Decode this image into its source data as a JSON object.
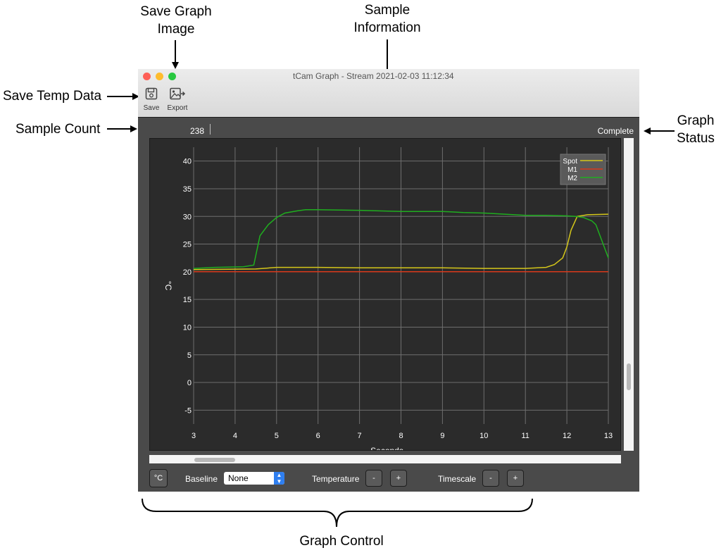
{
  "annotations": {
    "save_graph_image": [
      "Save Graph",
      "Image"
    ],
    "sample_information": [
      "Sample",
      "Information"
    ],
    "save_temp_data": "Save Temp Data",
    "sample_count": "Sample Count",
    "graph_status": [
      "Graph",
      "Status"
    ],
    "graph_control": "Graph Control"
  },
  "window": {
    "title": "tCam Graph - Stream 2021-02-03 11:12:34",
    "traffic_lights": {
      "close": "#fe5f57",
      "minimize": "#febc2e",
      "zoom": "#28c840"
    }
  },
  "toolbar": {
    "save_label": "Save",
    "export_label": "Export",
    "save_icon": "floppy-disk-icon",
    "export_icon": "image-export-icon"
  },
  "info_bar": {
    "sample_count": "238",
    "status": "Complete"
  },
  "controls": {
    "unit_button": "°C",
    "baseline_label": "Baseline",
    "baseline_value": "None",
    "temperature_label": "Temperature",
    "timescale_label": "Timescale",
    "minus": "-",
    "plus": "+"
  },
  "chart_data": {
    "type": "line",
    "title": "",
    "xlabel": "Seconds",
    "ylabel": "°C",
    "xlim": [
      3,
      13
    ],
    "ylim": [
      -7.5,
      42.5
    ],
    "xticks": [
      3,
      4,
      5,
      6,
      7,
      8,
      9,
      10,
      11,
      12,
      13
    ],
    "yticks": [
      -5,
      0,
      5,
      10,
      15,
      20,
      25,
      30,
      35,
      40
    ],
    "grid": true,
    "legend_position": "top-right",
    "colors": {
      "background": "#2b2b2b",
      "grid": "#6e6e6e",
      "text": "#ffffff"
    },
    "series": [
      {
        "name": "Spot",
        "color": "#d4c61a",
        "x": [
          3,
          4.5,
          5,
          6,
          7,
          8,
          9,
          10,
          11,
          11.5,
          11.7,
          11.9,
          12,
          12.1,
          12.25,
          12.5,
          13
        ],
        "y": [
          20.4,
          20.5,
          20.8,
          20.8,
          20.7,
          20.7,
          20.7,
          20.6,
          20.6,
          20.8,
          21.3,
          22.5,
          24.5,
          27.5,
          30.0,
          30.3,
          30.4
        ]
      },
      {
        "name": "M1",
        "color": "#d9391b",
        "x": [
          3,
          13
        ],
        "y": [
          20.0,
          20.0
        ]
      },
      {
        "name": "M2",
        "color": "#1fae1f",
        "x": [
          3,
          3.5,
          4.2,
          4.45,
          4.6,
          4.8,
          5,
          5.2,
          5.5,
          5.7,
          6,
          7,
          8,
          9,
          9.5,
          10,
          10.5,
          11,
          11.5,
          12,
          12.2,
          12.4,
          12.6,
          12.7,
          12.8,
          12.9,
          13
        ],
        "y": [
          20.6,
          20.8,
          20.9,
          21.2,
          26.5,
          28.5,
          29.8,
          30.6,
          31.0,
          31.2,
          31.2,
          31.1,
          30.9,
          30.9,
          30.7,
          30.6,
          30.4,
          30.2,
          30.2,
          30.1,
          30.0,
          29.8,
          29.2,
          28.5,
          26.5,
          24.5,
          22.5
        ]
      }
    ]
  }
}
